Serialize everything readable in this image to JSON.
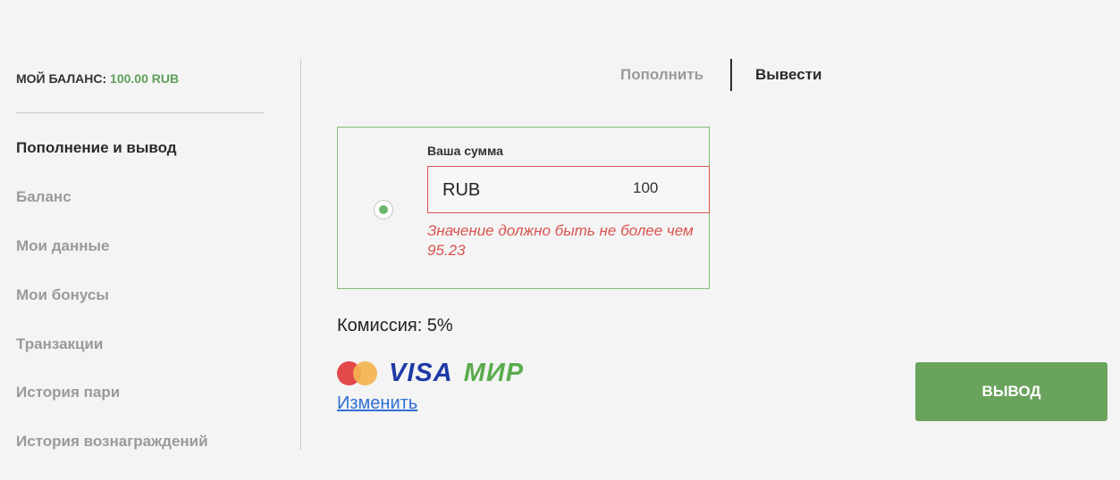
{
  "balance": {
    "label": "МОЙ БАЛАНС:",
    "amount": "100.00 RUB"
  },
  "sidebar": {
    "items": [
      {
        "label": "Пополнение и вывод",
        "active": true
      },
      {
        "label": "Баланс",
        "active": false
      },
      {
        "label": "Мои данные",
        "active": false
      },
      {
        "label": "Мои бонусы",
        "active": false
      },
      {
        "label": "Транзакции",
        "active": false
      },
      {
        "label": "История пари",
        "active": false
      },
      {
        "label": "История вознаграждений",
        "active": false
      }
    ]
  },
  "tabs": {
    "deposit": "Пополнить",
    "withdraw": "Вывести",
    "active": "withdraw"
  },
  "amount_card": {
    "label": "Ваша сумма",
    "currency": "RUB",
    "value": "100",
    "error": "Значение должно быть не более чем 95.23",
    "radio_selected": true
  },
  "commission": "Комиссия: 5%",
  "payment_methods": {
    "icons": [
      "mastercard-icon",
      "visa-icon",
      "mir-icon"
    ],
    "visa_text": "VISA",
    "mir_text": "МИР",
    "change_link": "Изменить"
  },
  "submit": {
    "label": "ВЫВОД"
  },
  "colors": {
    "accent_green": "#6aa35c",
    "balance_green": "#5fa05a",
    "error_red": "#d9534f",
    "link_blue": "#2f6fd6",
    "visa_blue": "#1d3aa6",
    "mir_green": "#5aab4c",
    "background": "#f4f4f4"
  }
}
